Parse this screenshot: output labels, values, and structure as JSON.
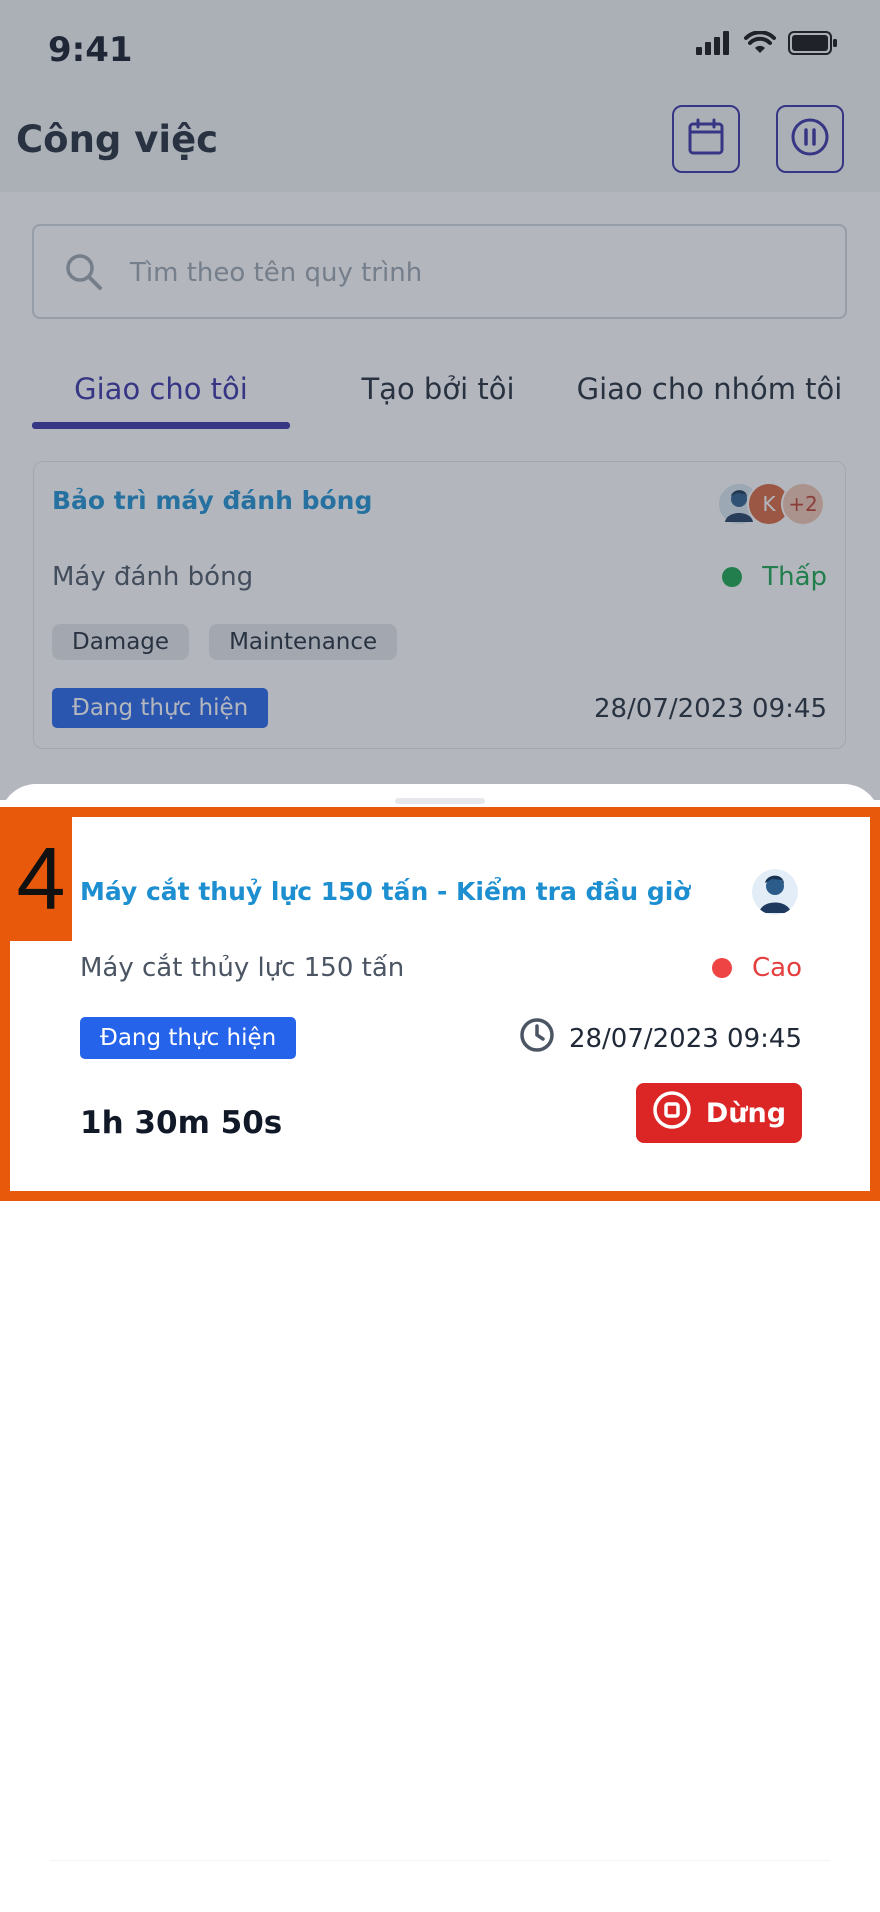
{
  "status_bar": {
    "time": "9:41"
  },
  "header": {
    "title": "Công việc"
  },
  "search": {
    "placeholder": "Tìm theo tên quy trình"
  },
  "tabs": [
    {
      "label": "Giao cho tôi",
      "active": true
    },
    {
      "label": "Tạo bởi tôi",
      "active": false
    },
    {
      "label": "Giao cho nhóm tôi",
      "active": false
    }
  ],
  "task_card": {
    "title": "Bảo trì máy đánh bóng",
    "machine": "Máy đánh bóng",
    "priority": "Thấp",
    "tags": [
      "Damage",
      "Maintenance"
    ],
    "status": "Đang thực hiện",
    "date": "28/07/2023 09:45",
    "avatar_initial": "K",
    "extra_assignees": "+2"
  },
  "active_task": {
    "step_number": "4",
    "title": "Máy cắt thuỷ lực 150 tấn - Kiểm tra đầu giờ",
    "machine": "Máy cắt thủy lực 150 tấn",
    "priority": "Cao",
    "status": "Đang thực hiện",
    "date": "28/07/2023 09:45",
    "timer": "1h 30m 50s",
    "stop_label": "Dừng"
  },
  "colors": {
    "accent": "#3730a3",
    "link": "#1d8fd1",
    "status_blue": "#2563eb",
    "priority_low": "#16a34a",
    "priority_high": "#e53e3e",
    "stop_red": "#dc2626",
    "highlight": "#e8590c"
  },
  "icons": [
    "signal-icon",
    "wifi-icon",
    "battery-icon",
    "calendar-icon",
    "pause-icon",
    "search-icon",
    "clock-icon",
    "stop-icon"
  ]
}
